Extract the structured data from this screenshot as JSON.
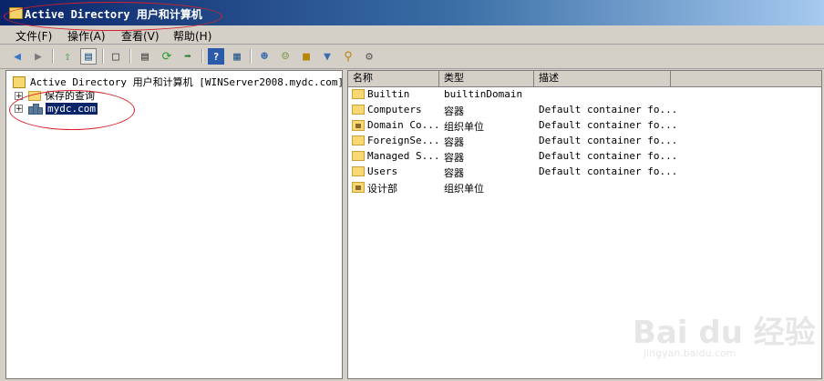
{
  "window": {
    "title": "Active Directory 用户和计算机"
  },
  "menu": [
    {
      "label": "文件(F)"
    },
    {
      "label": "操作(A)"
    },
    {
      "label": "查看(V)"
    },
    {
      "label": "帮助(H)"
    }
  ],
  "toolbar": {
    "buttons": [
      "back-arrow-icon",
      "forward-arrow-icon",
      "up-folder-icon",
      "show-hide-console-tree-icon",
      "delete-icon",
      "properties-icon",
      "refresh-icon",
      "export-list-icon",
      "help-icon",
      "action-pane-icon",
      "new-user-icon",
      "new-group-icon",
      "new-ou-icon",
      "filter-icon",
      "find-icon",
      "delegate-icon"
    ]
  },
  "tree": {
    "root": "Active Directory 用户和计算机 [WINServer2008.mydc.com]",
    "items": [
      {
        "label": "保存的查询",
        "expander": "+"
      },
      {
        "label": "mydc.com",
        "expander": "+"
      }
    ]
  },
  "list": {
    "columns": [
      "名称",
      "类型",
      "描述"
    ],
    "rows": [
      {
        "name": "Builtin",
        "type": "builtinDomain",
        "desc": "",
        "icon": "folder"
      },
      {
        "name": "Computers",
        "type": "容器",
        "desc": "Default container fo...",
        "icon": "folder"
      },
      {
        "name": "Domain Co...",
        "type": "组织单位",
        "desc": "Default container fo...",
        "icon": "ou"
      },
      {
        "name": "ForeignSe...",
        "type": "容器",
        "desc": "Default container fo...",
        "icon": "folder"
      },
      {
        "name": "Managed S...",
        "type": "容器",
        "desc": "Default container fo...",
        "icon": "folder"
      },
      {
        "name": "Users",
        "type": "容器",
        "desc": "Default container fo...",
        "icon": "folder"
      },
      {
        "name": "设计部",
        "type": "组织单位",
        "desc": "",
        "icon": "ou"
      }
    ]
  },
  "watermark": {
    "brand": "Bai du 经验",
    "url": "jingyan.baidu.com"
  },
  "colors": {
    "titlebar": "#0a246a",
    "selection": "#0a246a",
    "annotation": "#d8202a"
  }
}
